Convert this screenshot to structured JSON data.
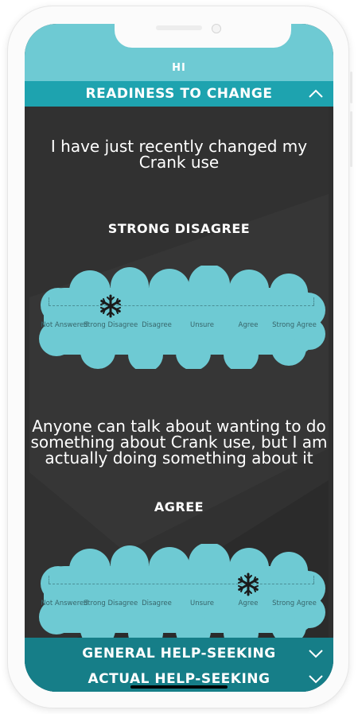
{
  "app": {
    "title": "HI"
  },
  "sections": [
    {
      "label": "READINESS TO CHANGE",
      "expanded": true,
      "chevron": "chevron-up-icon"
    },
    {
      "label": "GENERAL HELP-SEEKING",
      "expanded": false,
      "chevron": "chevron-down-icon"
    },
    {
      "label": "ACTUAL HELP-SEEKING",
      "expanded": false,
      "chevron": "chevron-down-icon"
    }
  ],
  "scale_options": [
    {
      "label": "Not Answered"
    },
    {
      "label": "Strong Disagree"
    },
    {
      "label": "Disagree"
    },
    {
      "label": "Unsure"
    },
    {
      "label": "Agree"
    },
    {
      "label": "Strong Agree"
    }
  ],
  "questions": [
    {
      "text": "I have just recently changed my Crank use",
      "answer": "STRONG DISAGREE",
      "selected_index": 1
    },
    {
      "text": "Anyone can talk about wanting to do something about Crank use, but I am actually doing something about it",
      "answer": "AGREE",
      "selected_index": 4
    }
  ],
  "colors": {
    "accent": "#6ecad3",
    "header": "#1ea3af",
    "footer": "#167e88",
    "background": "#313131",
    "slider_handle": "#1a1a1a"
  }
}
